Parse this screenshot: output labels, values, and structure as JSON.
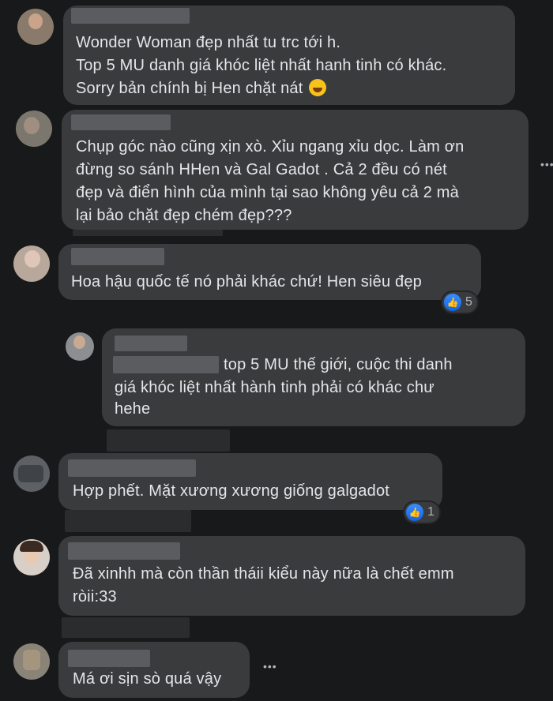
{
  "comments": [
    {
      "id": "c1",
      "lines": [
        "Wonder Woman đẹp nhất tu trc tới h.",
        "Top 5 MU danh giá khóc liệt nhất hanh tinh có khác.",
        "Sorry bản chính bị Hen chặt nát"
      ],
      "emoji": "rolling-on-floor-laughing-emoji"
    },
    {
      "id": "c2",
      "lines": [
        "Chụp góc nào cũng xịn xò. Xỉu ngang xỉu dọc. Làm ơn",
        "đừng so sánh HHen và Gal Gadot . Cả 2 đều có nét",
        "đẹp và điển hình của mình tại sao không yêu cả 2 mà",
        "lại bảo chặt đẹp chém đẹp???"
      ]
    },
    {
      "id": "c3",
      "lines": [
        "Hoa hậu quốc tế nó phải khác chứ! Hen siêu đẹp"
      ],
      "reaction_count": "5"
    },
    {
      "id": "c4-reply",
      "lines": [
        "top 5 MU thế giới, cuộc thi danh",
        "giá khóc liệt nhất hành tinh phải có khác chư",
        "hehe"
      ]
    },
    {
      "id": "c5",
      "lines": [
        "Hợp phết. Mặt xương xương giống galgadot"
      ],
      "reaction_count": "1"
    },
    {
      "id": "c6",
      "lines": [
        "Đã xinhh mà còn thần tháii kiểu này nữa là chết emm",
        "ròii:33"
      ]
    },
    {
      "id": "c7",
      "lines": [
        "Má ơi sịn sò quá vậy"
      ]
    }
  ],
  "more_options": "•••",
  "colors": {
    "background": "#18191a",
    "bubble": "#3a3b3c",
    "text": "#e4e6eb",
    "like_blue": "#1877f2"
  }
}
